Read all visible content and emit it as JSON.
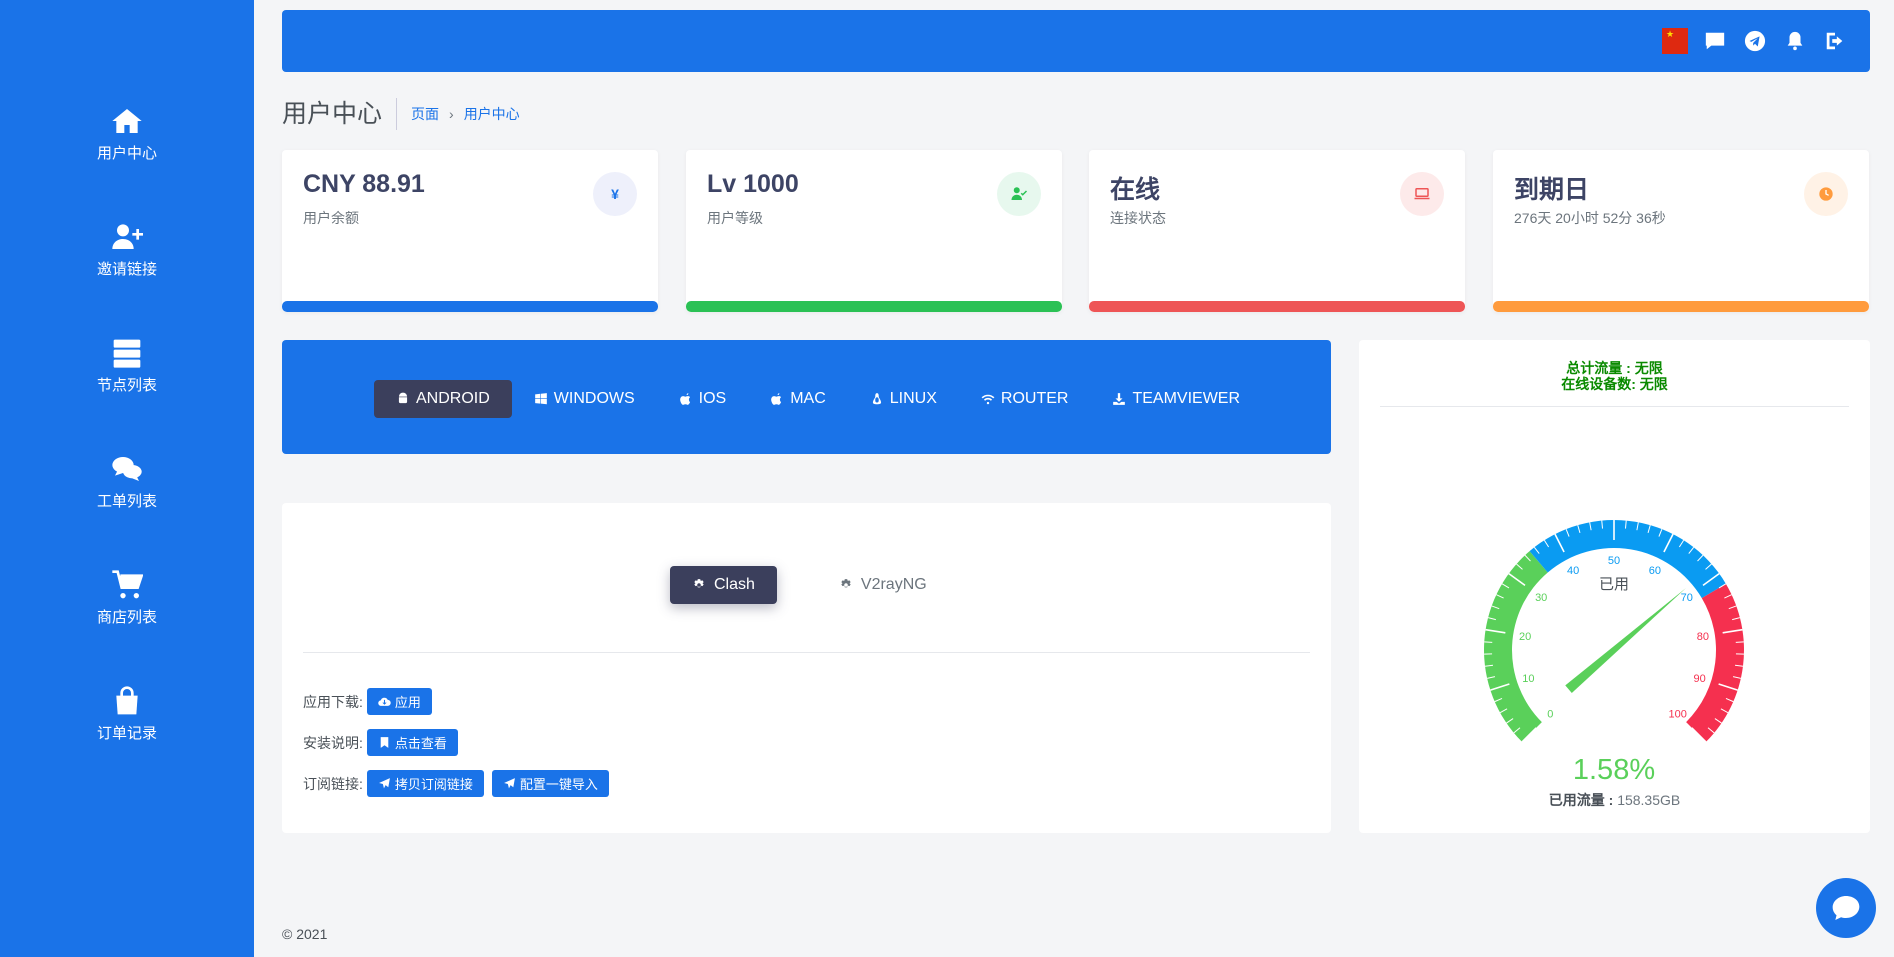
{
  "sidebar": {
    "items": [
      {
        "label": "用户中心",
        "icon": "home-icon"
      },
      {
        "label": "邀请链接",
        "icon": "user-plus-icon"
      },
      {
        "label": "节点列表",
        "icon": "server-icon"
      },
      {
        "label": "工单列表",
        "icon": "comments-icon"
      },
      {
        "label": "商店列表",
        "icon": "cart-icon"
      },
      {
        "label": "订单记录",
        "icon": "shopping-bag-icon"
      }
    ]
  },
  "header": {
    "icons": [
      "china-flag-icon",
      "message-icon",
      "telegram-icon",
      "bell-icon",
      "logout-icon"
    ]
  },
  "page": {
    "title": "用户中心",
    "breadcrumb": [
      "页面",
      "用户中心"
    ]
  },
  "stats": [
    {
      "value": "CNY 88.91",
      "label": "用户余额",
      "badge": "¥",
      "color": "#1a73e8",
      "tint": "#eef0fb",
      "icon": "yen-icon"
    },
    {
      "value": "Lv 1000",
      "label": "用户等级",
      "badge": "",
      "color": "#2bc155",
      "tint": "#e7f8ee",
      "icon": "user-check-icon"
    },
    {
      "value": "在线",
      "label": "连接状态",
      "badge": "",
      "color": "#ee5556",
      "tint": "#fdeaea",
      "icon": "laptop-icon"
    },
    {
      "value": "到期日",
      "label": "276天 20小时 52分 36秒",
      "badge": "",
      "color": "#ff9b3d",
      "tint": "#fff2e6",
      "icon": "clock-icon"
    }
  ],
  "os_tabs": [
    {
      "label": "ANDROID",
      "icon": "android-icon",
      "active": true
    },
    {
      "label": "WINDOWS",
      "icon": "windows-icon",
      "active": false
    },
    {
      "label": "IOS",
      "icon": "apple-icon",
      "active": false
    },
    {
      "label": "MAC",
      "icon": "apple-icon",
      "active": false
    },
    {
      "label": "LINUX",
      "icon": "linux-icon",
      "active": false
    },
    {
      "label": "ROUTER",
      "icon": "wifi-icon",
      "active": false
    },
    {
      "label": "TEAMVIEWER",
      "icon": "download-icon",
      "active": false
    }
  ],
  "client": {
    "tabs": [
      {
        "label": "Clash",
        "active": true
      },
      {
        "label": "V2rayNG",
        "active": false
      }
    ],
    "rows": [
      {
        "label": "应用下载:",
        "buttons": [
          {
            "label": "应用",
            "icon": "cloud-download-icon"
          }
        ]
      },
      {
        "label": "安装说明:",
        "buttons": [
          {
            "label": "点击查看",
            "icon": "bookmark-icon"
          }
        ]
      },
      {
        "label": "订阅链接:",
        "buttons": [
          {
            "label": "拷贝订阅链接",
            "icon": "paper-plane-icon"
          },
          {
            "label": "配置一键导入",
            "icon": "paper-plane-icon"
          }
        ]
      }
    ]
  },
  "gauge": {
    "total": "总计流量 : 无限",
    "devices": "在线设备数: 无限",
    "title": "已用",
    "percent": 1.58,
    "percent_label": "1.58%",
    "ticks": [
      "0",
      "10",
      "20",
      "30",
      "40",
      "50",
      "60",
      "70",
      "80",
      "90",
      "100"
    ],
    "used_label": "已用流量 :",
    "used_value": "158.35GB",
    "colors": {
      "green": "#5ad05a",
      "blue": "#0a9bf2",
      "red": "#f5304f"
    }
  },
  "footer": {
    "text": "© 2021"
  }
}
